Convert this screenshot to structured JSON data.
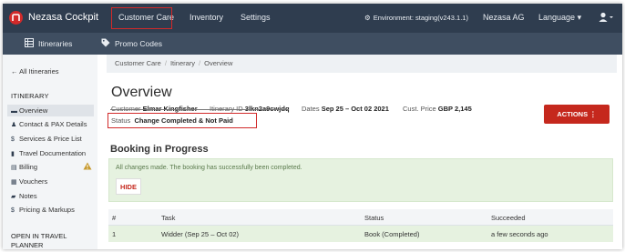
{
  "app": {
    "brand": "Nezasa Cockpit",
    "nav": [
      "Customer Care",
      "Inventory",
      "Settings"
    ],
    "environment": "Environment: staging(v243.1.1)",
    "company": "Nezasa AG",
    "language": "Language"
  },
  "subnav": [
    "Itineraries",
    "Promo Codes"
  ],
  "sidebar": {
    "back": "All Itineraries",
    "heading": "ITINERARY",
    "items": [
      {
        "label": "Overview",
        "icon": "briefcase-icon"
      },
      {
        "label": "Contact & PAX Details",
        "icon": "person-icon"
      },
      {
        "label": "Services & Price List",
        "icon": "dollar-icon"
      },
      {
        "label": "Travel Documentation",
        "icon": "document-icon"
      },
      {
        "label": "Billing",
        "icon": "billing-icon"
      },
      {
        "label": "Vouchers",
        "icon": "grid-icon"
      },
      {
        "label": "Notes",
        "icon": "comment-icon"
      },
      {
        "label": "Pricing & Markups",
        "icon": "dollar-icon"
      }
    ],
    "open_heading": "OPEN IN TRAVEL PLANNER"
  },
  "breadcrumb": [
    "Customer Care",
    "Itinerary",
    "Overview"
  ],
  "page": {
    "title": "Overview",
    "customer_label": "Customer",
    "customer": "Elmar Kingfisher",
    "itinerary_label": "Itinerary ID",
    "itinerary_id": "3lkn2a9cwjdq",
    "dates_label": "Dates",
    "dates": "Sep 25 – Oct 02 2021",
    "price_label": "Cust. Price",
    "price": "GBP 2,145",
    "status_label": "Status",
    "status": "Change Completed & Not Paid",
    "actions": "ACTIONS ⋮"
  },
  "booking": {
    "title": "Booking in Progress",
    "message": "All changes made. The booking has successfully been completed.",
    "hide": "HIDE",
    "columns": [
      "#",
      "Task",
      "Status",
      "Succeeded"
    ],
    "rows": [
      {
        "num": "1",
        "task": "Widder (Sep 25 – Oct 02)",
        "status": "Book (Completed)",
        "succeeded": "a few seconds ago"
      }
    ]
  },
  "colors": {
    "topnav": "#2f3d4f",
    "subnav": "#3f4e61",
    "accent": "#c5281d",
    "success_bg": "#e6f2e0"
  }
}
